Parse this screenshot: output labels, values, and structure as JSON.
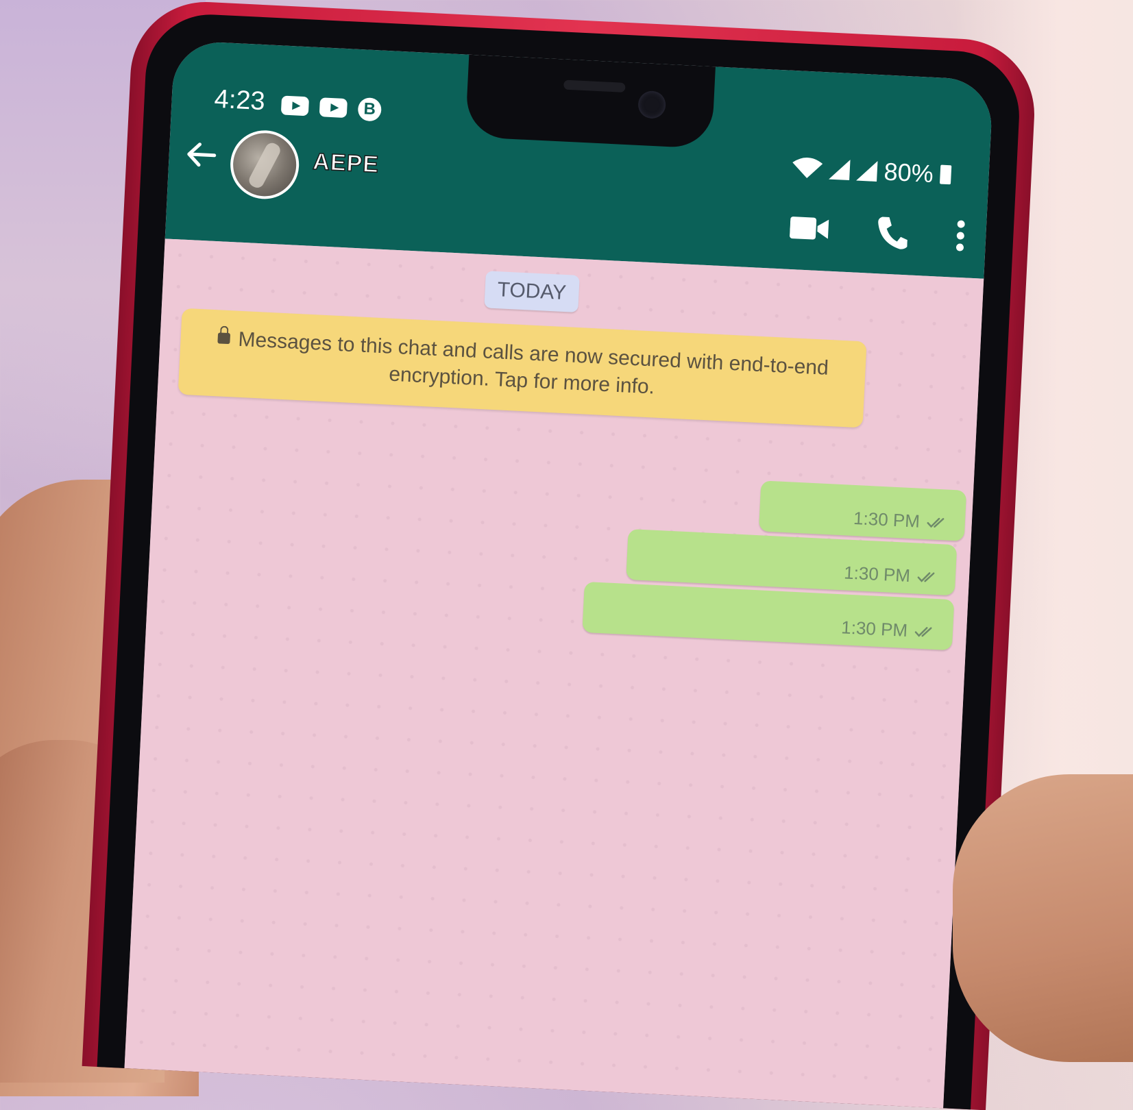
{
  "status_bar": {
    "time": "4:23",
    "battery": "80%",
    "left_icons": [
      "youtube-icon",
      "youtube-icon",
      "b-app-icon"
    ],
    "b_app_glyph": "B",
    "right_icons": [
      "wifi-icon",
      "signal-icon",
      "signal-icon",
      "battery-icon"
    ]
  },
  "header": {
    "contact_name": "AEPE",
    "actions": [
      "video-call-icon",
      "voice-call-icon",
      "more-menu-icon"
    ]
  },
  "chat": {
    "date_chip": "TODAY",
    "encryption_notice": "Messages to this chat and calls are now secured with end-to-end encryption. Tap for more info.",
    "messages": [
      {
        "time": "1:30 PM",
        "status": "read"
      },
      {
        "time": "1:30 PM",
        "status": "read"
      },
      {
        "time": "1:30 PM",
        "status": "read"
      }
    ]
  },
  "colors": {
    "app_bar": "#0b6158",
    "chat_background": "#eec8d6",
    "outgoing_bubble": "#b7e18b",
    "notice_background": "#f6d77a",
    "date_chip_background": "#d6dcf4",
    "phone_frame": "#e23350"
  }
}
